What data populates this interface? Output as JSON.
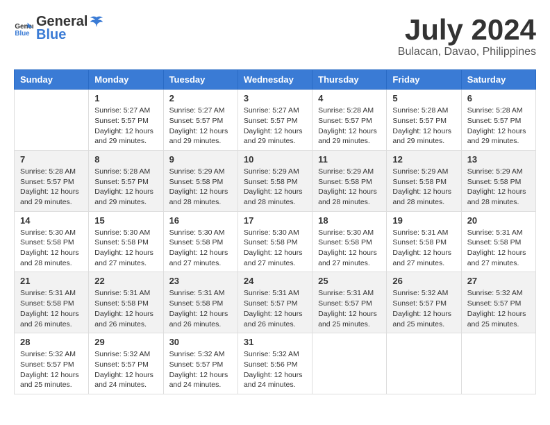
{
  "logo": {
    "text_general": "General",
    "text_blue": "Blue"
  },
  "title": "July 2024",
  "subtitle": "Bulacan, Davao, Philippines",
  "days_header": [
    "Sunday",
    "Monday",
    "Tuesday",
    "Wednesday",
    "Thursday",
    "Friday",
    "Saturday"
  ],
  "weeks": [
    {
      "days": [
        {
          "num": "",
          "info": ""
        },
        {
          "num": "1",
          "info": "Sunrise: 5:27 AM\nSunset: 5:57 PM\nDaylight: 12 hours\nand 29 minutes."
        },
        {
          "num": "2",
          "info": "Sunrise: 5:27 AM\nSunset: 5:57 PM\nDaylight: 12 hours\nand 29 minutes."
        },
        {
          "num": "3",
          "info": "Sunrise: 5:27 AM\nSunset: 5:57 PM\nDaylight: 12 hours\nand 29 minutes."
        },
        {
          "num": "4",
          "info": "Sunrise: 5:28 AM\nSunset: 5:57 PM\nDaylight: 12 hours\nand 29 minutes."
        },
        {
          "num": "5",
          "info": "Sunrise: 5:28 AM\nSunset: 5:57 PM\nDaylight: 12 hours\nand 29 minutes."
        },
        {
          "num": "6",
          "info": "Sunrise: 5:28 AM\nSunset: 5:57 PM\nDaylight: 12 hours\nand 29 minutes."
        }
      ]
    },
    {
      "days": [
        {
          "num": "7",
          "info": "Sunrise: 5:28 AM\nSunset: 5:57 PM\nDaylight: 12 hours\nand 29 minutes."
        },
        {
          "num": "8",
          "info": "Sunrise: 5:28 AM\nSunset: 5:57 PM\nDaylight: 12 hours\nand 29 minutes."
        },
        {
          "num": "9",
          "info": "Sunrise: 5:29 AM\nSunset: 5:58 PM\nDaylight: 12 hours\nand 28 minutes."
        },
        {
          "num": "10",
          "info": "Sunrise: 5:29 AM\nSunset: 5:58 PM\nDaylight: 12 hours\nand 28 minutes."
        },
        {
          "num": "11",
          "info": "Sunrise: 5:29 AM\nSunset: 5:58 PM\nDaylight: 12 hours\nand 28 minutes."
        },
        {
          "num": "12",
          "info": "Sunrise: 5:29 AM\nSunset: 5:58 PM\nDaylight: 12 hours\nand 28 minutes."
        },
        {
          "num": "13",
          "info": "Sunrise: 5:29 AM\nSunset: 5:58 PM\nDaylight: 12 hours\nand 28 minutes."
        }
      ]
    },
    {
      "days": [
        {
          "num": "14",
          "info": "Sunrise: 5:30 AM\nSunset: 5:58 PM\nDaylight: 12 hours\nand 28 minutes."
        },
        {
          "num": "15",
          "info": "Sunrise: 5:30 AM\nSunset: 5:58 PM\nDaylight: 12 hours\nand 27 minutes."
        },
        {
          "num": "16",
          "info": "Sunrise: 5:30 AM\nSunset: 5:58 PM\nDaylight: 12 hours\nand 27 minutes."
        },
        {
          "num": "17",
          "info": "Sunrise: 5:30 AM\nSunset: 5:58 PM\nDaylight: 12 hours\nand 27 minutes."
        },
        {
          "num": "18",
          "info": "Sunrise: 5:30 AM\nSunset: 5:58 PM\nDaylight: 12 hours\nand 27 minutes."
        },
        {
          "num": "19",
          "info": "Sunrise: 5:31 AM\nSunset: 5:58 PM\nDaylight: 12 hours\nand 27 minutes."
        },
        {
          "num": "20",
          "info": "Sunrise: 5:31 AM\nSunset: 5:58 PM\nDaylight: 12 hours\nand 27 minutes."
        }
      ]
    },
    {
      "days": [
        {
          "num": "21",
          "info": "Sunrise: 5:31 AM\nSunset: 5:58 PM\nDaylight: 12 hours\nand 26 minutes."
        },
        {
          "num": "22",
          "info": "Sunrise: 5:31 AM\nSunset: 5:58 PM\nDaylight: 12 hours\nand 26 minutes."
        },
        {
          "num": "23",
          "info": "Sunrise: 5:31 AM\nSunset: 5:58 PM\nDaylight: 12 hours\nand 26 minutes."
        },
        {
          "num": "24",
          "info": "Sunrise: 5:31 AM\nSunset: 5:57 PM\nDaylight: 12 hours\nand 26 minutes."
        },
        {
          "num": "25",
          "info": "Sunrise: 5:31 AM\nSunset: 5:57 PM\nDaylight: 12 hours\nand 25 minutes."
        },
        {
          "num": "26",
          "info": "Sunrise: 5:32 AM\nSunset: 5:57 PM\nDaylight: 12 hours\nand 25 minutes."
        },
        {
          "num": "27",
          "info": "Sunrise: 5:32 AM\nSunset: 5:57 PM\nDaylight: 12 hours\nand 25 minutes."
        }
      ]
    },
    {
      "days": [
        {
          "num": "28",
          "info": "Sunrise: 5:32 AM\nSunset: 5:57 PM\nDaylight: 12 hours\nand 25 minutes."
        },
        {
          "num": "29",
          "info": "Sunrise: 5:32 AM\nSunset: 5:57 PM\nDaylight: 12 hours\nand 24 minutes."
        },
        {
          "num": "30",
          "info": "Sunrise: 5:32 AM\nSunset: 5:57 PM\nDaylight: 12 hours\nand 24 minutes."
        },
        {
          "num": "31",
          "info": "Sunrise: 5:32 AM\nSunset: 5:56 PM\nDaylight: 12 hours\nand 24 minutes."
        },
        {
          "num": "",
          "info": ""
        },
        {
          "num": "",
          "info": ""
        },
        {
          "num": "",
          "info": ""
        }
      ]
    }
  ]
}
